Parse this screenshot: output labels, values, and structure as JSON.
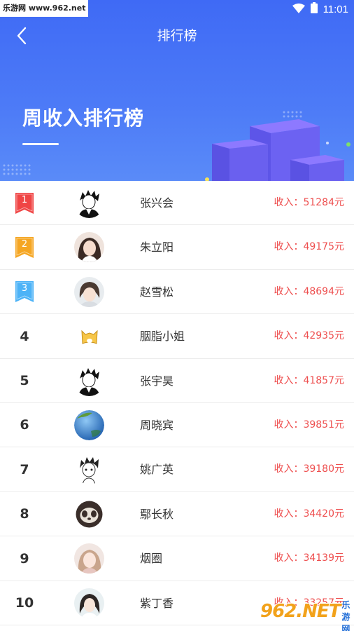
{
  "watermark": {
    "top_left": "乐游网 www.962.net",
    "brand": "962.NET",
    "brand_sub": "乐游网"
  },
  "status_bar": {
    "time": "11:01",
    "wifi_icon": "wifi-icon",
    "battery_icon": "battery-icon"
  },
  "nav": {
    "title": "排行榜",
    "back_icon": "chevron-left-icon"
  },
  "hero": {
    "title": "周收入排行榜"
  },
  "colors": {
    "header_blue": "#3f6af5",
    "income_red": "#ee4f4f",
    "rank1": "#f04545",
    "rank2": "#f5a623",
    "rank3": "#4db3f7"
  },
  "ranking": [
    {
      "rank": "1",
      "name": "张兴会",
      "income": "收入：51284元",
      "avatar": "manga-boy"
    },
    {
      "rank": "2",
      "name": "朱立阳",
      "income": "收入：49175元",
      "avatar": "girl-photo"
    },
    {
      "rank": "3",
      "name": "赵雪松",
      "income": "收入：48694元",
      "avatar": "girl-photo-2"
    },
    {
      "rank": "4",
      "name": "胭脂小姐",
      "income": "收入：42935元",
      "avatar": "yellow-cat"
    },
    {
      "rank": "5",
      "name": "张宇昊",
      "income": "收入：41857元",
      "avatar": "manga-boy"
    },
    {
      "rank": "6",
      "name": "周晓宾",
      "income": "收入：39851元",
      "avatar": "globe"
    },
    {
      "rank": "7",
      "name": "姚广英",
      "income": "收入：39180元",
      "avatar": "sketch-boy"
    },
    {
      "rank": "8",
      "name": "鄢长秋",
      "income": "收入：34420元",
      "avatar": "sloth"
    },
    {
      "rank": "9",
      "name": "烟圈",
      "income": "收入：34139元",
      "avatar": "girl-photo-3"
    },
    {
      "rank": "10",
      "name": "紫丁香",
      "income": "收入：33257元",
      "avatar": "girl-photo-4"
    }
  ]
}
